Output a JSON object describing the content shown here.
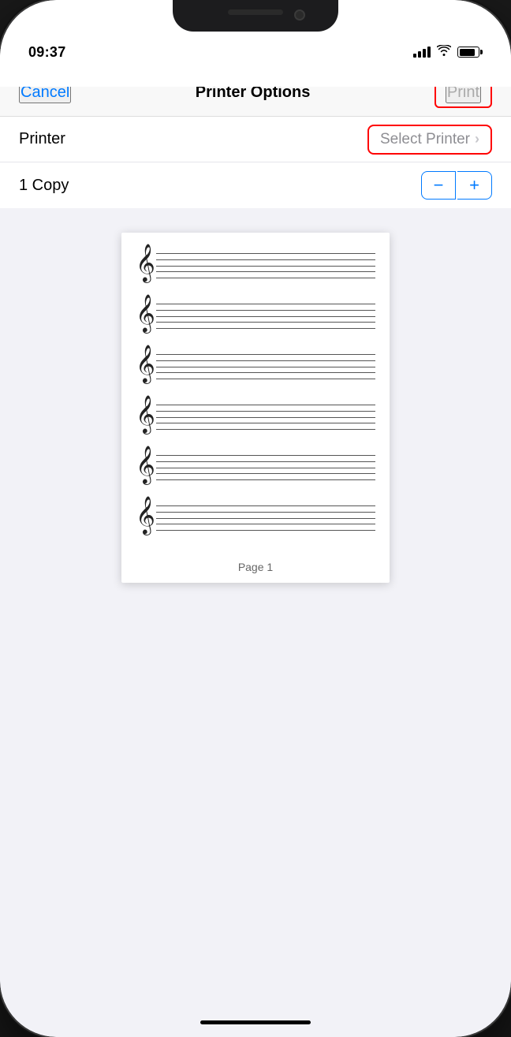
{
  "status_bar": {
    "time": "09:37",
    "signal_bars": [
      6,
      9,
      12,
      15
    ],
    "wifi": "wifi",
    "battery_level": 85
  },
  "nav": {
    "cancel_label": "Cancel",
    "title": "Printer Options",
    "print_label": "Print"
  },
  "rows": [
    {
      "label": "Printer",
      "value": "Select Printer",
      "type": "select"
    },
    {
      "label": "1 Copy",
      "type": "stepper",
      "minus": "−",
      "plus": "+"
    }
  ],
  "preview": {
    "page_label": "Page 1",
    "staff_count": 6
  },
  "colors": {
    "accent": "#007aff",
    "danger": "#ff0000",
    "text_primary": "#000000",
    "text_secondary": "#8e8e93",
    "background": "#f2f2f7",
    "card": "#ffffff",
    "border": "#e5e5ea"
  }
}
